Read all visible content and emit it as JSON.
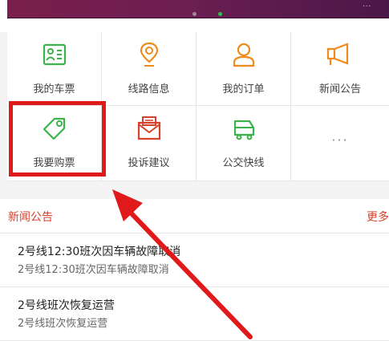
{
  "banner": {
    "text": "..."
  },
  "grid": {
    "row1": [
      {
        "label": "我的车票",
        "icon": "ticket-card-icon"
      },
      {
        "label": "线路信息",
        "icon": "location-pin-icon"
      },
      {
        "label": "我的订单",
        "icon": "user-icon"
      },
      {
        "label": "新闻公告",
        "icon": "megaphone-icon"
      }
    ],
    "row2": [
      {
        "label": "我要购票",
        "icon": "tag-icon"
      },
      {
        "label": "投诉建议",
        "icon": "mail-icon"
      },
      {
        "label": "公交快线",
        "icon": "bus-icon"
      },
      {
        "label": "···",
        "icon": "more-icon"
      }
    ]
  },
  "news": {
    "title": "新闻公告",
    "more": "更多",
    "items": [
      {
        "title": "2号线12:30班次因车辆故障取消",
        "summary": "2号线12:30班次因车辆故障取消"
      },
      {
        "title": "2号线班次恢复运营",
        "summary": "2号线班次恢复运营"
      }
    ]
  },
  "colors": {
    "accent": "#d9412b",
    "icon_orange": "#f08a1c",
    "icon_green": "#3bb34a",
    "highlight": "#e01a1a"
  }
}
